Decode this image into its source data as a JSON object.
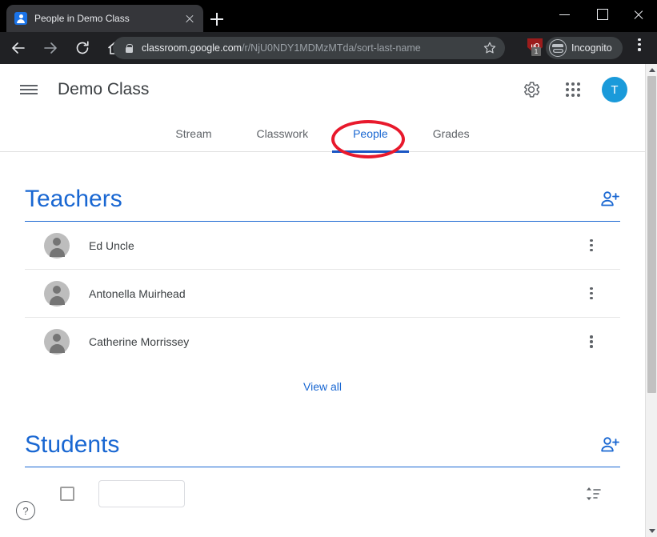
{
  "browser": {
    "tab": {
      "title": "People in Demo Class",
      "favicon": "people-favicon"
    },
    "new_tab_label": "+",
    "window_controls": {
      "minimize": "minimize-icon",
      "maximize": "maximize-icon",
      "close": "close-icon"
    },
    "nav": {
      "back": "back-arrow-icon",
      "forward": "forward-arrow-icon",
      "reload": "reload-icon",
      "home": "home-icon"
    },
    "omnibox": {
      "lock": "lock-icon",
      "host": "classroom.google.com",
      "path": "/r/NjU0NDY1MDMzMTda/sort-last-name",
      "bookmark": "star-icon"
    },
    "extension": {
      "name": "ublock-origin",
      "glyph": "uO",
      "badge": "1"
    },
    "profile": {
      "label": "Incognito",
      "icon": "incognito-icon"
    },
    "menu": "chrome-menu-icon"
  },
  "app": {
    "menu_icon": "hamburger-icon",
    "title": "Demo Class",
    "settings_icon": "gear-icon",
    "apps_icon": "apps-grid-icon",
    "avatar_initial": "T",
    "tabs": [
      {
        "label": "Stream",
        "active": false
      },
      {
        "label": "Classwork",
        "active": false
      },
      {
        "label": "People",
        "active": true
      },
      {
        "label": "Grades",
        "active": false
      }
    ]
  },
  "teachers": {
    "title": "Teachers",
    "invite_icon": "invite-teacher-icon",
    "people": [
      {
        "name": "Ed Uncle",
        "avatar": "default-avatar",
        "menu": "more-options-icon"
      },
      {
        "name": "Antonella Muirhead",
        "avatar": "default-avatar",
        "menu": "more-options-icon"
      },
      {
        "name": "Catherine Morrissey",
        "avatar": "default-avatar",
        "menu": "more-options-icon"
      }
    ],
    "view_all": "View all"
  },
  "students": {
    "title": "Students",
    "invite_icon": "invite-student-icon",
    "select_all": "select-all-checkbox",
    "actions_button": "",
    "sort_icon": "sort-icon"
  },
  "help": {
    "label": "?",
    "name": "help-button"
  },
  "annotation": {
    "shape": "ellipse",
    "color": "#e8192c",
    "target": "People"
  },
  "colors": {
    "accent_blue": "#1967d2",
    "tab_underline": "#1a56c4",
    "avatar_blue": "#1a9ada",
    "annotation_red": "#e8192c"
  },
  "scrollbar": {
    "up": "scroll-up-arrow",
    "down": "scroll-down-arrow",
    "thumb": "scroll-thumb"
  }
}
